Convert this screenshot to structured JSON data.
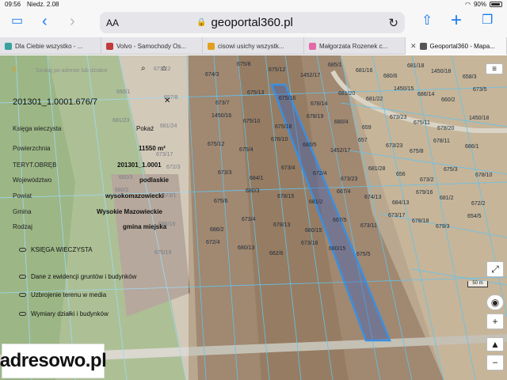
{
  "status_bar": {
    "time": "09:56",
    "date": "Niedz. 2.08",
    "battery": "90%"
  },
  "browser": {
    "text_size_label": "AA",
    "url": "geoportal360.pl",
    "tabs": [
      {
        "title": "Dla Ciebie wszystko - ...",
        "favicon_color": "#3aa0a0",
        "active": false
      },
      {
        "title": "Volvo - Samochody Os...",
        "favicon_color": "#c33a3a",
        "active": false
      },
      {
        "title": "cisowi usichy wszystk...",
        "favicon_color": "#e2a020",
        "active": false
      },
      {
        "title": "Małgorzata Rozenek c...",
        "favicon_color": "#e36aa6",
        "active": false
      },
      {
        "title": "Geoportal360 - Mapa...",
        "favicon_color": "#555555",
        "active": true
      }
    ]
  },
  "panel": {
    "search_placeholder": "Szukaj po adresie lub działce",
    "parcel_id": "201301_1.0001.676/7",
    "rows": [
      {
        "label": "Księga wieczysta",
        "value": "Pokaż"
      },
      {
        "label": "Powierzchnia",
        "value": "11550 m²"
      },
      {
        "label": "TERYT.OBRĘB",
        "value": "201301_1.0001"
      },
      {
        "label": "Województwo",
        "value": "podlaskie"
      },
      {
        "label": "Powiat",
        "value": "wysokomazowiecki"
      },
      {
        "label": "Gmina",
        "value": "Wysokie Mazowieckie"
      },
      {
        "label": "Rodzaj",
        "value": "gmina miejska"
      }
    ],
    "links": [
      "KSIĘGA WIECZYSTA",
      "Dane z ewidencji gruntów i budynków",
      "Uzbrojenie terenu w media",
      "Wymiary działki i budynków"
    ]
  },
  "map": {
    "scale_label": "50 m",
    "parcel_labels": [
      "658/4",
      "673/22",
      "674/3",
      "675/8",
      "675/12",
      "1452/17",
      "685/1",
      "681/16",
      "680/6",
      "681/18",
      "1450/18",
      "658/3",
      "660/1",
      "657/8",
      "673/7",
      "675/13",
      "675/16",
      "678/14",
      "681/20",
      "681/22",
      "1450/15",
      "686/14",
      "660/2",
      "673/5",
      "681/23",
      "681/24",
      "1450/16",
      "675/10",
      "675/18",
      "678/19",
      "680/4",
      "659",
      "673/23",
      "675/11",
      "678/20",
      "1450/18",
      "660/4",
      "673/17",
      "675/12",
      "675/4",
      "678/10",
      "680/5",
      "1452/17",
      "657",
      "673/23",
      "675/8",
      "678/11",
      "686/1",
      "660/3",
      "672/3",
      "673/3",
      "684/1",
      "673/4",
      "672/4",
      "673/23",
      "681/28",
      "656",
      "673/2",
      "675/3",
      "678/10",
      "680/2",
      "673/1",
      "675/6",
      "680/3",
      "678/15",
      "681/2",
      "667/4",
      "674/13",
      "684/13",
      "679/16",
      "681/2",
      "672/2",
      "680/14",
      "686/16",
      "686/2",
      "673/4",
      "678/13",
      "680/15",
      "667/5",
      "673/11",
      "673/17",
      "678/18",
      "679/3",
      "654/5",
      "672/3",
      "675/19",
      "672/4",
      "680/13",
      "662/6",
      "673/18",
      "680/15",
      "675/5"
    ],
    "watermark": "adresowo.pl"
  },
  "colors": {
    "accent": "#1a7cf2",
    "selection": "#3b8fe0",
    "parcel_line": "#62c3f0"
  }
}
